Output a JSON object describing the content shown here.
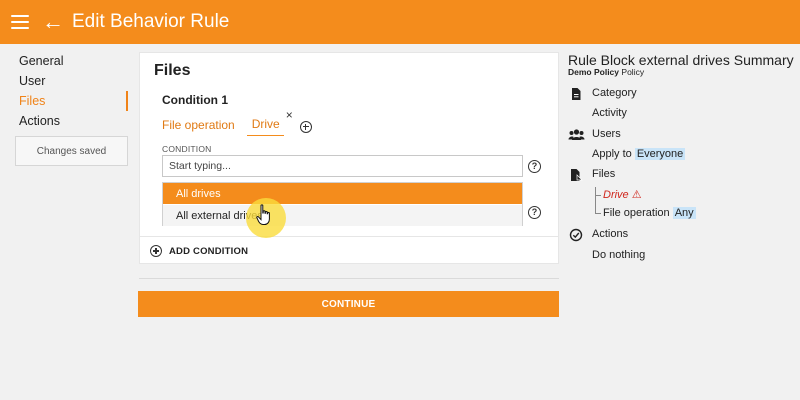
{
  "header": {
    "title": "Edit Behavior Rule"
  },
  "sidebar": {
    "items": [
      {
        "label": "General"
      },
      {
        "label": "User"
      },
      {
        "label": "Files"
      },
      {
        "label": "Actions"
      }
    ],
    "active": "Files",
    "saved_label": "Changes saved"
  },
  "files_card": {
    "title": "Files",
    "condition_title": "Condition 1",
    "tabs": [
      {
        "label": "File operation"
      },
      {
        "label": "Drive"
      }
    ],
    "remove_tab_glyph": "×",
    "condition_label": "CONDITION",
    "condition_placeholder": "Start typing...",
    "help_glyph": "?",
    "dropdown_options": [
      {
        "label": "All drives",
        "highlighted": true
      },
      {
        "label": "All external drives",
        "highlighted": false
      }
    ],
    "add_condition_label": "ADD CONDITION"
  },
  "continue_label": "CONTINUE",
  "summary": {
    "title": "Rule Block external drives Summary",
    "policy_name": "Demo Policy",
    "policy_suffix": "Policy",
    "sections": {
      "category": {
        "label": "Category",
        "value": "Activity",
        "icon": "document-icon"
      },
      "users": {
        "label": "Users",
        "prefix": "Apply to",
        "value": "Everyone",
        "icon": "users-icon"
      },
      "files": {
        "label": "Files",
        "icon": "file-icon",
        "drive_label": "Drive",
        "drive_warning_glyph": "⚠",
        "operation_label": "File operation",
        "operation_value": "Any"
      },
      "actions": {
        "label": "Actions",
        "value": "Do nothing",
        "icon": "check-circle-icon"
      }
    }
  },
  "colors": {
    "accent": "#f48c1c",
    "highlight_pill": "#c9e4f8",
    "error": "#d0281e"
  }
}
